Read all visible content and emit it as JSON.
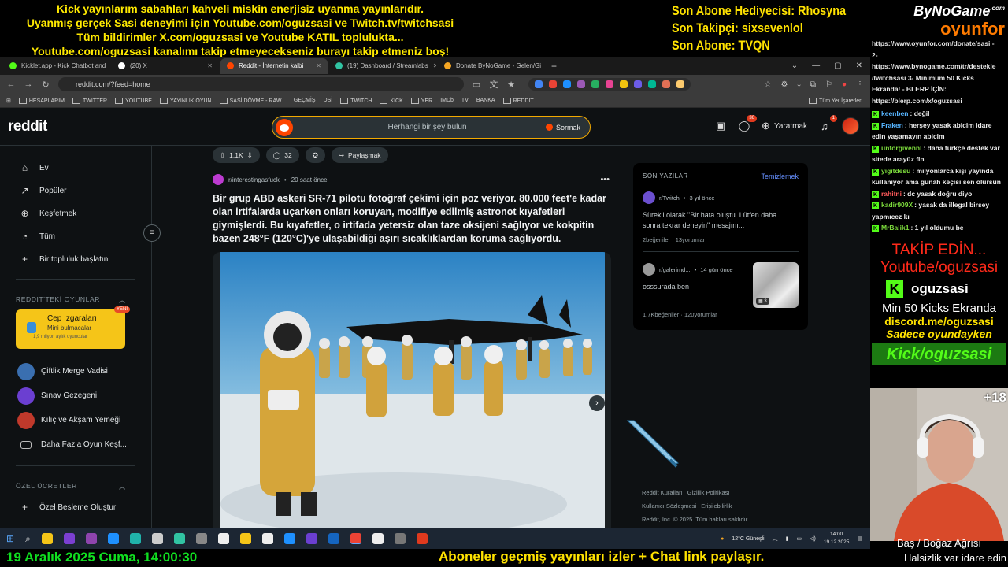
{
  "overlay": {
    "ticker": [
      "Kick yayınlarım sabahları kahveli miskin enerjisiz uyanma yayınlarıdır.",
      "Uyanmış gerçek Sasi deneyimi için Youtube.com/oguzsasi ve Twitch.tv/twitchsasi",
      "Tüm bildirimler X.com/oguzsasi ve Youtube KATIL toplulukta...",
      "Youtube.com/oguzsasi kanalımı takip etmeyecekseniz burayı takip etmeniz boş!"
    ],
    "stats": [
      "Son Abone Hediyecisi: Rhosyna",
      "Son Takipçi: sixsevenlol",
      "Son Abone: TVQN"
    ],
    "brand_top": "ByNoGame",
    "brand_top_sup": ".com",
    "brand_bottom": "oyunfor",
    "bottom_date": "19 Aralık 2025 Cuma, 14:00:30",
    "bottom_msg": "Aboneler geçmiş yayınları izler + Chat link paylaşır.",
    "colors": {
      "yellow": "#ffea00",
      "green": "#10e020",
      "orange": "#ff7b00",
      "kick": "#53fc18"
    }
  },
  "browser": {
    "tabs": [
      {
        "label": "Kicklet.app - Kick Chatbot and",
        "color": "#53fc18",
        "icon": "kicklet-favicon",
        "active": false
      },
      {
        "label": "(20) X",
        "color": "#ffffff",
        "icon": "x-favicon",
        "active": false
      },
      {
        "label": "Reddit - İnternetin kalbi",
        "color": "#ff4500",
        "icon": "reddit-favicon",
        "active": true
      },
      {
        "label": "(19) Dashboard / Streamlabs",
        "color": "#31c3a2",
        "icon": "streamlabs-favicon",
        "active": false
      },
      {
        "label": "Donate ByNoGame - Gelen/Gi",
        "color": "#f5a623",
        "icon": "bynogame-favicon",
        "active": false
      }
    ],
    "url": "reddit.com/?feed=home",
    "bookmarks": [
      "HESAPLARIM",
      "TWITTER",
      "YOUTUBE",
      "YAYINLIK OYUN",
      "SASİ DÖVME - RAW...",
      "GEÇMİŞ",
      "DSİ",
      "TWITCH",
      "KICK",
      "YER",
      "IMDb",
      "TV",
      "BANKA",
      "REDDIT"
    ],
    "bookmarks_end": "Tüm Yer İşaretleri"
  },
  "reddit": {
    "logo": "reddit",
    "search_placeholder": "Herhangi bir şey bulun",
    "ask_label": "Sormak",
    "create_label": "Yaratmak",
    "chat_badge": "36",
    "notif_badge": "1",
    "nav": [
      {
        "label": "Ev",
        "icon": "home-icon",
        "glyph": "⌂"
      },
      {
        "label": "Popüler",
        "icon": "popular-icon",
        "glyph": "↗"
      },
      {
        "label": "Keşfetmek",
        "icon": "explore-icon",
        "glyph": "⊕"
      },
      {
        "label": "Tüm",
        "icon": "all-icon",
        "glyph": "◔"
      },
      {
        "label": "Bir topluluk başlatın",
        "icon": "plus-icon",
        "glyph": "+"
      }
    ],
    "games_section": "REDDIT'TEKİ OYUNLAR",
    "featured_game": {
      "title": "Cep Izgaraları",
      "subtitle": "Mini bulmacalar",
      "users": "1,9 milyon aylık oyuncular",
      "badge": "YENİ"
    },
    "games": [
      {
        "label": "Çiftlik Merge Vadisi",
        "color": "#3a6fb0"
      },
      {
        "label": "Sınav Gezegeni",
        "color": "#6b3fd1"
      },
      {
        "label": "Kılıç ve Akşam Yemeği",
        "color": "#c0392b"
      },
      {
        "label": "Daha Fazla Oyun Keşf...",
        "color": "#0e1113"
      }
    ],
    "feeds_section": "ÖZEL ÜCRETLER",
    "custom_feed": "Özel Besleme Oluştur",
    "post": {
      "upvotes": "1.1K",
      "comments": "32",
      "share": "Paylaşmak",
      "subreddit": "r/interestingasfuck",
      "time": "20 saat önce",
      "title": "Bir grup ABD askeri SR-71 pilotu fotoğraf çekimi için poz veriyor. 80.000 feet'e kadar olan irtifalarda uçarken onları koruyan, modifiye edilmiş astronot kıyafetleri giymişlerdi. Bu kıyafetler, o irtifada yetersiz olan taze oksijeni sağlıyor ve kokpitin bazen 248°F (120°C)'ye ulaşabildiği aşırı sıcaklıklardan koruma sağlıyordu."
    },
    "recent": {
      "heading": "SON YAZILAR",
      "clear": "Temizlemek",
      "items": [
        {
          "sub": "r/Twitch",
          "time": "3 yıl önce",
          "text": "Sürekli olarak \"Bir hata oluştu. Lütfen daha sonra tekrar deneyin\" mesajını...",
          "likes": "2beğeniler",
          "comments": "13yorumlar"
        },
        {
          "sub": "r/galerimd...",
          "time": "14 gün önce",
          "text": "osssurada ben",
          "likes": "1.7Kbeğeniler",
          "comments": "120yorumlar",
          "thumb_count": "3"
        }
      ]
    },
    "footer": {
      "links": [
        "Reddit Kuralları",
        "Gizlilik Politikası",
        "Kullanıcı Sözleşmesi",
        "Erişilebilirlik"
      ],
      "copyright": "Reddit, Inc. © 2025. Tüm hakları saklıdır."
    }
  },
  "taskbar": {
    "weather": "12°C  Güneşli",
    "time": "14:00",
    "date": "19.12.2025",
    "icons": [
      "#53a0ff",
      "#c9c9c9",
      "#f5c518",
      "#6b3fd1",
      "#7b3fd1",
      "#1e90ff",
      "#20b2aa",
      "#cccccc",
      "#3a6fb0",
      "#cccccc",
      "#f5c518",
      "#eeeeee",
      "#1e90ff",
      "#6b3fd1",
      "#1565c0",
      "#ea4335",
      "#eeeeee",
      "#777777",
      "#e03a1e"
    ]
  },
  "panel": {
    "donate_lines": [
      "https://www.oyunfor.com/donate/sasi -",
      "2-",
      "https://www.bynogame.com/tr/destekle",
      "/twitchsasi 3- Minimum 50 Kicks",
      "Ekranda! - BLERP İÇİN:",
      "https://blerp.com/x/oguzsasi"
    ],
    "chat": [
      {
        "user": "keenben",
        "color": "#56b4ff",
        "text": ": değil"
      },
      {
        "user": "Fraken",
        "color": "#56b4ff",
        "text": ": herşey yasak abicim idare edin yaşamayın abicim"
      },
      {
        "user": "unforgivennl",
        "color": "#7ddc3c",
        "text": ": daha türkçe destek var sitede arayüz fln"
      },
      {
        "user": "yigitdesu",
        "color": "#7ddc3c",
        "text": ": milyonlarca kişi yayında kullanıyor ama günah keçisi sen olursun"
      },
      {
        "user": "rahitni",
        "color": "#ff5a5a",
        "text": ": dc yasak doğru diyo"
      },
      {
        "user": "kadir909X",
        "color": "#7ddc3c",
        "text": ": yasak da illegal birsey yapmıcez kı"
      },
      {
        "user": "MrBalik1",
        "color": "#7ddc3c",
        "text": ": 1 yıl oldumu be"
      }
    ],
    "takip": "TAKİP EDİN...",
    "youtube": "Youtube/oguzsasi",
    "kick_name": "oguzsasi",
    "min_kicks": "Min 50 Kicks Ekranda",
    "discord": "discord.me/oguzsasi",
    "oyunda": "Sadece oyundayken",
    "kick_link": "Kick/oguzsasi",
    "plus18": "+18",
    "status1": "Baş / Boğaz Ağrısı",
    "status2": "Halsizlik var idare edin"
  }
}
